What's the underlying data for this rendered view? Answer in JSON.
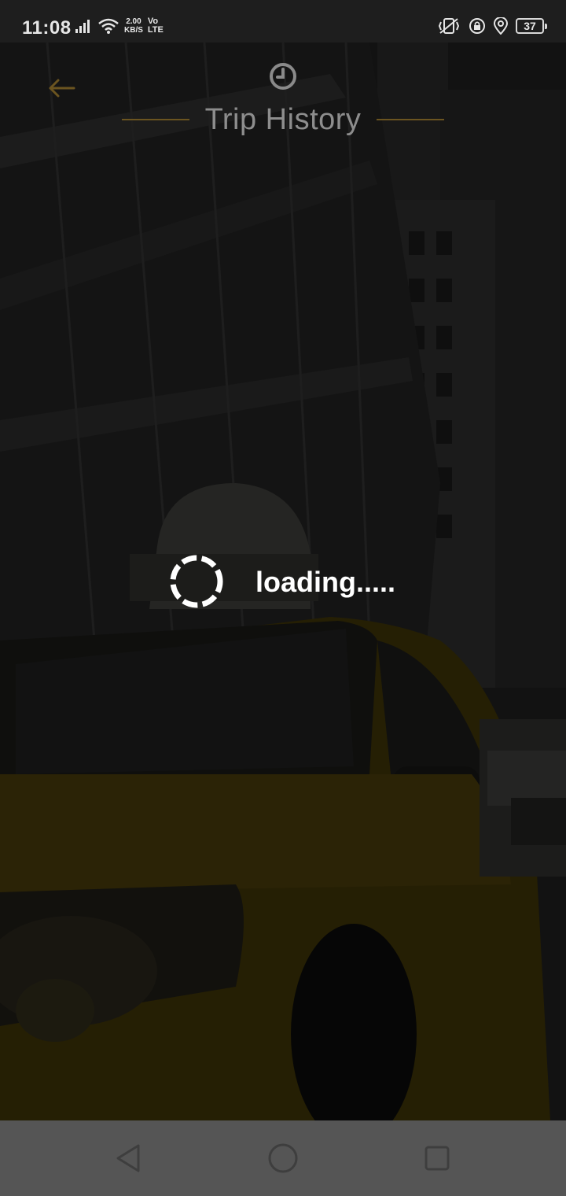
{
  "status_bar": {
    "time": "11:08",
    "net_speed_value": "2.00",
    "net_speed_unit": "KB/S",
    "volte_top": "Vo",
    "volte_bottom": "LTE",
    "battery_level": "37",
    "icons": [
      "signal-icon",
      "wifi-icon",
      "vibrate-icon",
      "lock-icon",
      "location-icon",
      "battery-icon"
    ]
  },
  "header": {
    "title": "Trip History",
    "back_icon": "back-arrow-icon",
    "title_icon": "clock-icon",
    "accent_color": "#6b5420"
  },
  "loading": {
    "text": "loading.....",
    "icon": "spinner-icon"
  },
  "nav_bar": {
    "buttons": [
      "back-triangle-icon",
      "home-circle-icon",
      "recents-square-icon"
    ]
  }
}
